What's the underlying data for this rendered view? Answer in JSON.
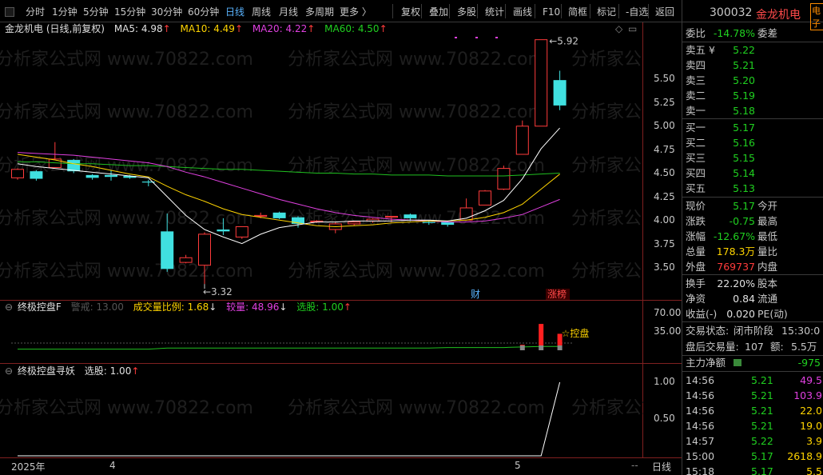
{
  "toolbar": {
    "items": [
      "分时",
      "1分钟",
      "5分钟",
      "15分钟",
      "30分钟",
      "60分钟",
      "日线",
      "周线",
      "月线",
      "多周期",
      "更多 〉",
      "复权",
      "叠加",
      "多股",
      "统计",
      "画线",
      "F10",
      "简框",
      "标记",
      "-自选",
      "返回"
    ],
    "active_index": 6
  },
  "main_chart": {
    "title": "金龙机电 (日线,前复权)",
    "ma5_label": "MA5:",
    "ma5_value": "4.98",
    "ma10_label": "MA10:",
    "ma10_value": "4.49",
    "ma20_label": "MA20:",
    "ma20_value": "4.22",
    "ma60_label": "MA60:",
    "ma60_value": "4.50",
    "up_arrow": "↑",
    "high_label": "5.92",
    "low_label": "←3.32",
    "event_cai": "财",
    "event_zhangbang": "涨榜",
    "y_ticks": [
      "5.50",
      "5.25",
      "5.00",
      "4.75",
      "4.50",
      "4.25",
      "4.00",
      "3.75",
      "3.50"
    ],
    "diamond": "◇",
    "scroll_mark": "▭",
    "colors": {
      "ma5": "#ffffff",
      "ma10": "#ffd400",
      "ma20": "#e040e0",
      "ma60": "#20c020",
      "up": "#ff3b3b",
      "down": "#40e0e0"
    }
  },
  "indicator1": {
    "name": "终极控盘F",
    "warn_label": "警戒:",
    "warn_value": "13.00",
    "ratio_label": "成交量比例:",
    "ratio_value": "1.68",
    "vol_label": "较量:",
    "vol_value": "48.96",
    "pick_label": "选股:",
    "pick_value": "1.00",
    "down_arrow": "↓",
    "up_arrow": "↑",
    "control_label": "☆控盘",
    "y_ticks": [
      "70.00",
      "35.00"
    ]
  },
  "indicator2": {
    "name": "终极控盘寻妖",
    "pick_label": "选股:",
    "pick_value": "1.00",
    "up_arrow": "↑",
    "y_ticks": [
      "1.00",
      "0.50"
    ]
  },
  "x_axis": {
    "labels": [
      "2025年",
      "4",
      "5"
    ],
    "period": "日线",
    "minus": "--"
  },
  "quote": {
    "code": "300032",
    "name": "金龙机电",
    "tag": "电子",
    "weibi_label": "委比",
    "weibi_value": "-14.78%",
    "weicha_label": "委差",
    "asks": [
      {
        "label": "卖五 ¥",
        "price": "5.22"
      },
      {
        "label": "卖四",
        "price": "5.21"
      },
      {
        "label": "卖三",
        "price": "5.20"
      },
      {
        "label": "卖二",
        "price": "5.19"
      },
      {
        "label": "卖一",
        "price": "5.18"
      }
    ],
    "bids": [
      {
        "label": "买一",
        "price": "5.17"
      },
      {
        "label": "买二",
        "price": "5.16"
      },
      {
        "label": "买三",
        "price": "5.15"
      },
      {
        "label": "买四",
        "price": "5.14"
      },
      {
        "label": "买五",
        "price": "5.13"
      }
    ],
    "stats": [
      {
        "l": "现价",
        "v": "5.17",
        "vc": "green",
        "l2": "今开"
      },
      {
        "l": "涨跌",
        "v": "-0.75",
        "vc": "green",
        "l2": "最高"
      },
      {
        "l": "涨幅",
        "v": "-12.67%",
        "vc": "green",
        "l2": "最低"
      },
      {
        "l": "总量",
        "v": "178.3万",
        "vc": "yellow",
        "l2": "量比"
      },
      {
        "l": "外盘",
        "v": "769737",
        "vc": "red",
        "l2": "内盘"
      }
    ],
    "stats2": [
      {
        "l": "换手",
        "v": "22.20%",
        "l2": "股本"
      },
      {
        "l": "净资",
        "v": "0.84",
        "l2": "流通"
      },
      {
        "l": "收益(-)",
        "v": "0.020",
        "l2": "PE(动)"
      }
    ],
    "trade_state_label": "交易状态:",
    "trade_state_value": "闭市阶段",
    "trade_state_time": "15:30:0",
    "after_label": "盘后交易量:",
    "after_value": "107",
    "after_amt_label": "额:",
    "after_amt_value": "5.5万",
    "netflow_label": "主力净额",
    "netflow_value": "-975",
    "ticks": [
      {
        "t": "14:56",
        "p": "5.21",
        "q": "49.5",
        "qc": "magenta"
      },
      {
        "t": "14:56",
        "p": "5.21",
        "q": "103.9",
        "qc": "magenta"
      },
      {
        "t": "14:56",
        "p": "5.21",
        "q": "22.0",
        "qc": "yellow"
      },
      {
        "t": "14:56",
        "p": "5.21",
        "q": "19.0",
        "qc": "yellow"
      },
      {
        "t": "14:57",
        "p": "5.22",
        "q": "3.9",
        "qc": "yellow"
      },
      {
        "t": "15:00",
        "p": "5.17",
        "q": "2618.9",
        "qc": "yellow"
      },
      {
        "t": "15:18",
        "p": "5.17",
        "q": "5.5",
        "qc": "yellow"
      }
    ]
  },
  "watermark": "分析家公式网 www.70822.com",
  "chart_data": {
    "type": "candlestick",
    "ylim": [
      3.3,
      6.0
    ],
    "candles": [
      {
        "o": 4.45,
        "h": 4.55,
        "l": 4.43,
        "c": 4.54
      },
      {
        "o": 4.52,
        "h": 4.53,
        "l": 4.42,
        "c": 4.44
      },
      {
        "o": 4.56,
        "h": 4.83,
        "l": 4.56,
        "c": 4.65
      },
      {
        "o": 4.64,
        "h": 4.65,
        "l": 4.5,
        "c": 4.52
      },
      {
        "o": 4.48,
        "h": 4.49,
        "l": 4.43,
        "c": 4.45
      },
      {
        "o": 4.48,
        "h": 4.53,
        "l": 4.42,
        "c": 4.46
      },
      {
        "o": 4.47,
        "h": 4.48,
        "l": 4.44,
        "c": 4.45
      },
      {
        "o": 4.41,
        "h": 4.43,
        "l": 4.36,
        "c": 4.4
      },
      {
        "o": 3.88,
        "h": 4.07,
        "l": 3.45,
        "c": 3.48
      },
      {
        "o": 3.55,
        "h": 3.63,
        "l": 3.54,
        "c": 3.6
      },
      {
        "o": 3.52,
        "h": 3.87,
        "l": 3.32,
        "c": 3.85
      },
      {
        "o": 3.9,
        "h": 4.02,
        "l": 3.84,
        "c": 3.88
      },
      {
        "o": 3.82,
        "h": 3.93,
        "l": 3.8,
        "c": 3.93
      },
      {
        "o": 4.04,
        "h": 4.08,
        "l": 4.02,
        "c": 4.05
      },
      {
        "o": 4.08,
        "h": 4.09,
        "l": 4.01,
        "c": 4.02
      },
      {
        "o": 4.03,
        "h": 4.04,
        "l": 3.92,
        "c": 3.96
      },
      {
        "o": 3.98,
        "h": 4.0,
        "l": 3.97,
        "c": 3.99
      },
      {
        "o": 3.9,
        "h": 3.98,
        "l": 3.86,
        "c": 3.96
      },
      {
        "o": 3.96,
        "h": 3.99,
        "l": 3.94,
        "c": 3.98
      },
      {
        "o": 3.99,
        "h": 4.02,
        "l": 3.97,
        "c": 4.01
      },
      {
        "o": 4.03,
        "h": 4.04,
        "l": 3.98,
        "c": 4.04
      },
      {
        "o": 4.06,
        "h": 4.07,
        "l": 3.99,
        "c": 4.02
      },
      {
        "o": 3.98,
        "h": 4.0,
        "l": 3.95,
        "c": 3.97
      },
      {
        "o": 3.98,
        "h": 3.99,
        "l": 3.93,
        "c": 3.95
      },
      {
        "o": 4.0,
        "h": 4.23,
        "l": 4.0,
        "c": 4.13
      },
      {
        "o": 4.16,
        "h": 4.32,
        "l": 4.16,
        "c": 4.31
      },
      {
        "o": 4.33,
        "h": 4.58,
        "l": 4.32,
        "c": 4.55
      },
      {
        "o": 4.7,
        "h": 5.06,
        "l": 4.7,
        "c": 5.0
      },
      {
        "o": 5.0,
        "h": 5.92,
        "l": 5.0,
        "c": 5.92
      },
      {
        "o": 5.49,
        "h": 5.59,
        "l": 5.17,
        "c": 5.22
      }
    ],
    "ma5": [
      4.6,
      4.57,
      4.55,
      4.53,
      4.51,
      4.49,
      4.47,
      4.45,
      4.25,
      4.05,
      3.9,
      3.82,
      3.75,
      3.85,
      3.92,
      3.95,
      3.98,
      3.98,
      3.99,
      3.99,
      3.99,
      4.0,
      4.0,
      3.99,
      4.02,
      4.1,
      4.21,
      4.44,
      4.76,
      4.98
    ],
    "ma10": [
      4.7,
      4.67,
      4.64,
      4.6,
      4.57,
      4.53,
      4.49,
      4.46,
      4.36,
      4.27,
      4.2,
      4.12,
      4.06,
      4.03,
      4.0,
      3.97,
      3.94,
      3.93,
      3.94,
      3.95,
      3.97,
      3.98,
      3.99,
      3.99,
      4.0,
      4.03,
      4.08,
      4.17,
      4.33,
      4.49
    ],
    "ma20": [
      4.72,
      4.71,
      4.7,
      4.69,
      4.67,
      4.65,
      4.63,
      4.61,
      4.57,
      4.51,
      4.46,
      4.4,
      4.34,
      4.28,
      4.22,
      4.17,
      4.12,
      4.08,
      4.05,
      4.03,
      4.01,
      4.0,
      3.99,
      3.98,
      3.98,
      3.99,
      4.02,
      4.06,
      4.14,
      4.22
    ],
    "ma60": [
      4.62,
      4.62,
      4.61,
      4.6,
      4.6,
      4.59,
      4.58,
      4.58,
      4.57,
      4.56,
      4.55,
      4.54,
      4.54,
      4.53,
      4.52,
      4.51,
      4.5,
      4.5,
      4.49,
      4.49,
      4.48,
      4.48,
      4.48,
      4.47,
      4.47,
      4.47,
      4.47,
      4.48,
      4.49,
      4.5
    ],
    "ind1_bars": [
      0,
      0,
      0,
      0,
      0,
      0,
      0,
      0,
      0,
      0,
      0,
      0,
      0,
      0,
      0,
      0,
      0,
      0,
      0,
      0,
      0,
      0,
      0,
      0,
      0,
      0,
      0,
      10,
      48,
      30
    ],
    "ind1_line": [
      2,
      2,
      2,
      2,
      2,
      2,
      2,
      2,
      4,
      4,
      4,
      4,
      4,
      4,
      4,
      4,
      4,
      4,
      4,
      4,
      4,
      4,
      4,
      5,
      5,
      5,
      5,
      6,
      7,
      7
    ],
    "ind2_line": [
      0,
      0,
      0,
      0,
      0,
      0,
      0,
      0,
      0,
      0,
      0,
      0,
      0,
      0,
      0,
      0,
      0,
      0,
      0,
      0,
      0,
      0,
      0,
      0,
      0,
      0,
      0,
      0,
      0,
      1
    ]
  }
}
